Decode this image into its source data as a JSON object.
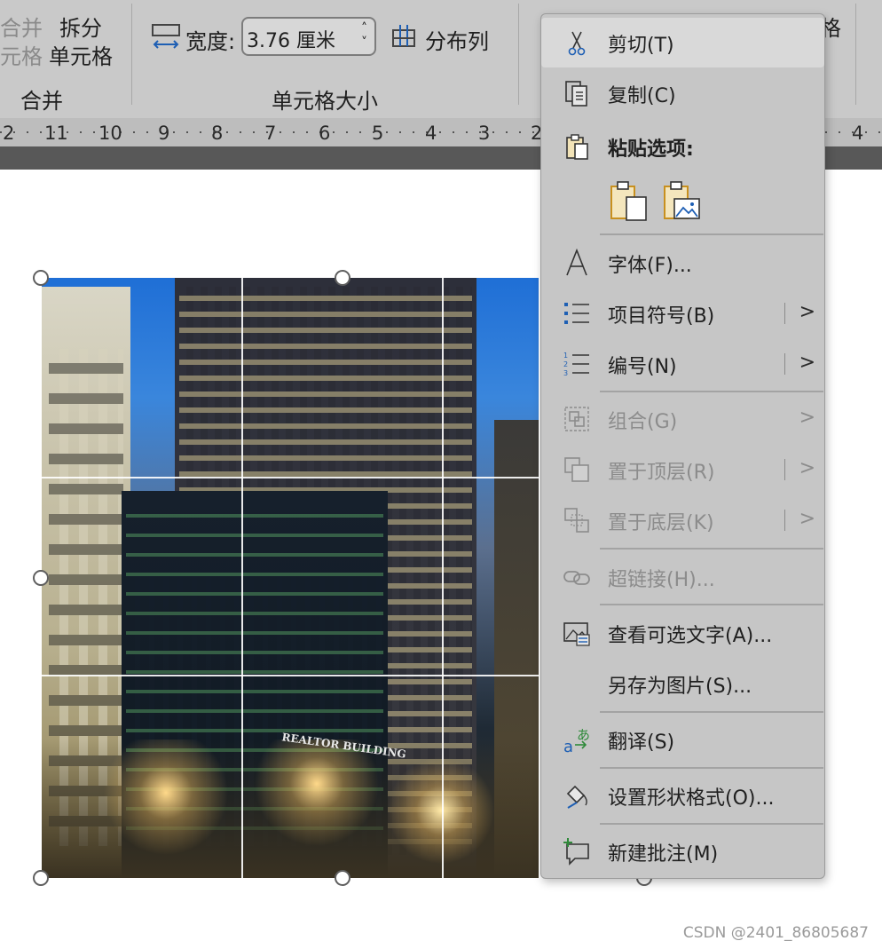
{
  "ribbon": {
    "merge_btn_line1": "合并",
    "merge_btn_line2": "元格",
    "split_btn_line1": "拆分",
    "split_btn_line2": "单元格",
    "merge_group_label": "合并",
    "width_label": "宽度:",
    "width_value": "3.76 厘米",
    "distribute_cols": "分布列",
    "size_group_label": "单元格大小",
    "right_partial": "格"
  },
  "ruler": {
    "ticks": [
      "2",
      "11",
      "10",
      "9",
      "8",
      "7",
      "6",
      "5",
      "4",
      "3",
      "2",
      "4"
    ]
  },
  "context_menu": {
    "cut": "剪切(T)",
    "copy": "复制(C)",
    "paste_options": "粘贴选项:",
    "font": "字体(F)...",
    "bullets": "项目符号(B)",
    "numbering": "编号(N)",
    "group": "组合(G)",
    "bring_front": "置于顶层(R)",
    "send_back": "置于底层(K)",
    "hyperlink": "超链接(H)...",
    "alt_text": "查看可选文字(A)...",
    "save_as_picture": "另存为图片(S)...",
    "translate": "翻译(S)",
    "format_shape": "设置形状格式(O)...",
    "new_comment": "新建批注(M)",
    "submenu_arrow": ">"
  },
  "image_text": "REALTOR BUILDING",
  "watermark": "CSDN @2401_86805687",
  "colors": {
    "ribbon_bg": "#c9c9c9",
    "menu_bg": "#c6c6c6",
    "menu_hover": "#d9d9d9",
    "icon_blue": "#1e5fb4",
    "icon_gold": "#d9a22a"
  }
}
